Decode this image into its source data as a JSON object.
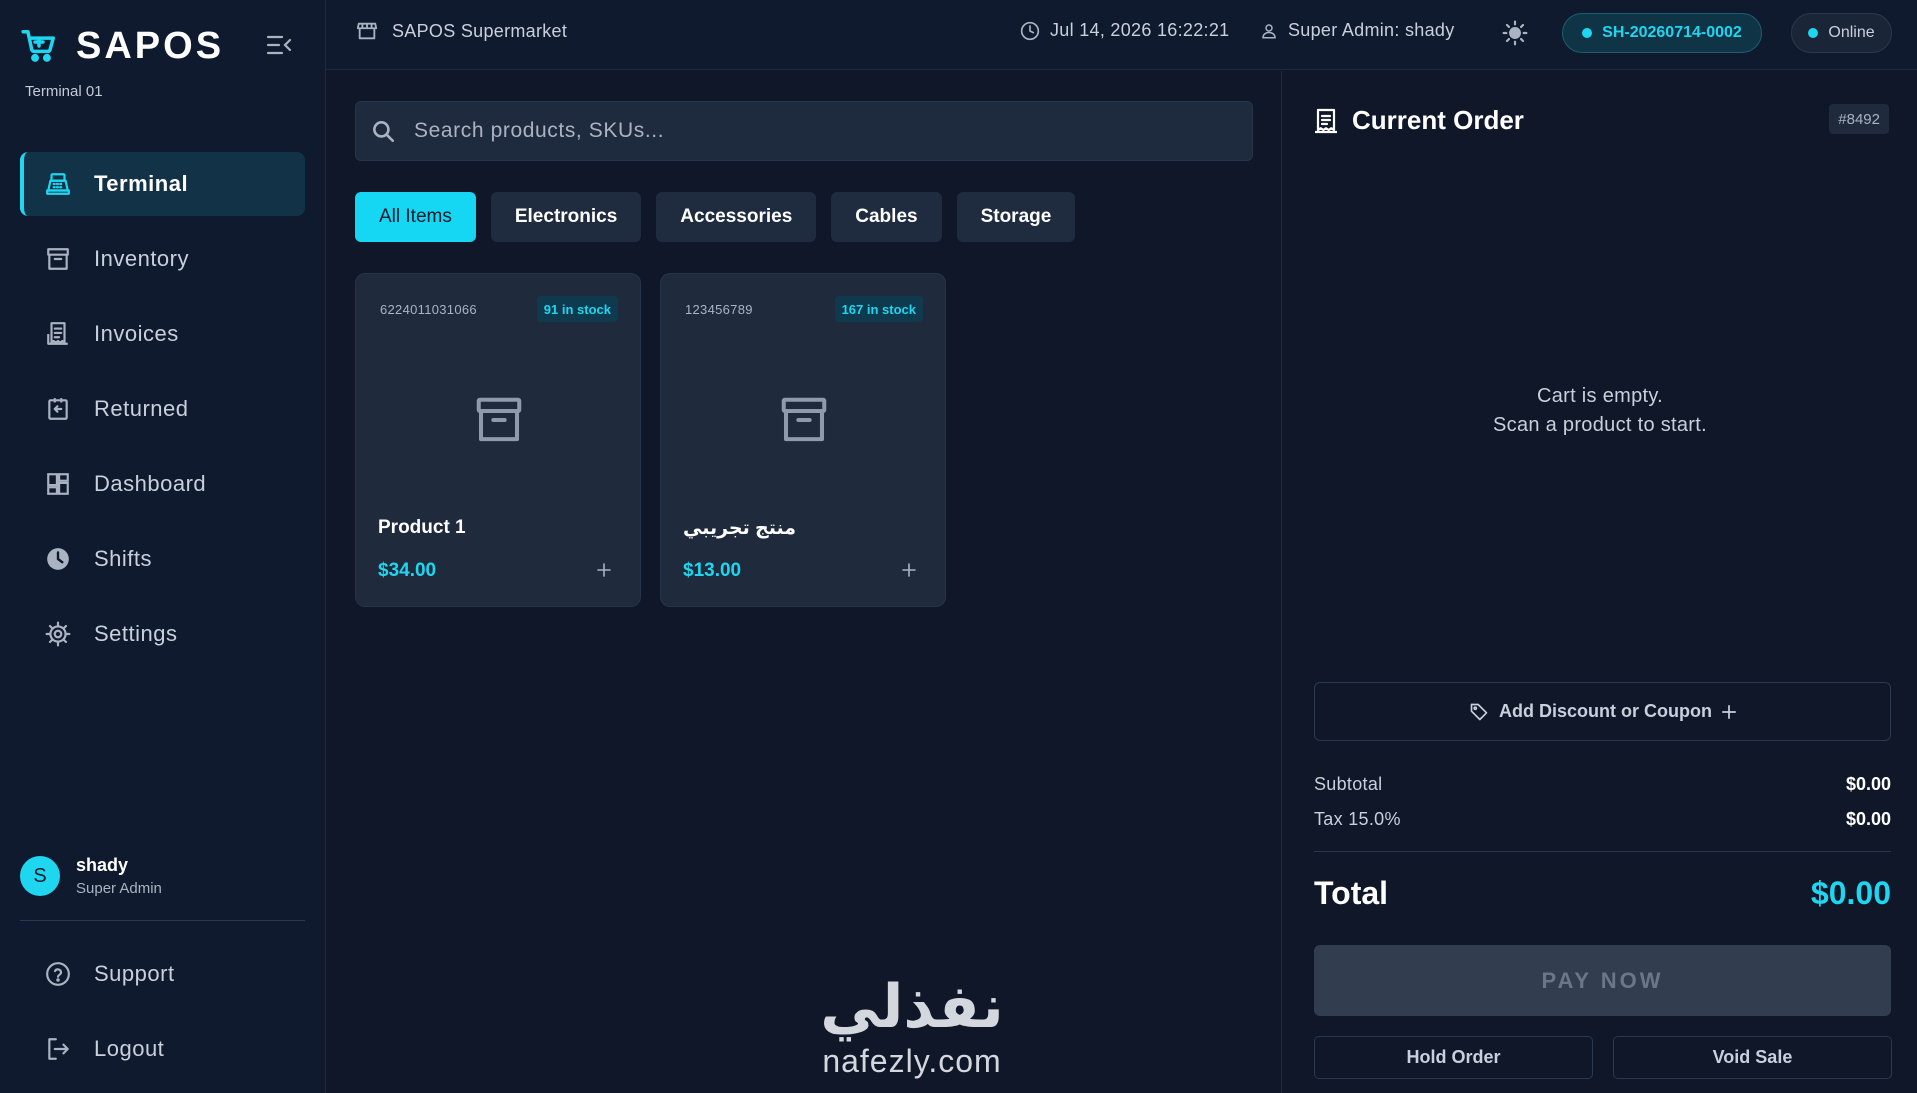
{
  "brand": {
    "name": "SAPOS",
    "terminal": "Terminal 01",
    "accent": "#1fd6f0"
  },
  "sidebar": {
    "items": [
      {
        "label": "Terminal",
        "icon": "register-icon",
        "active": true
      },
      {
        "label": "Inventory",
        "icon": "archive-icon"
      },
      {
        "label": "Invoices",
        "icon": "receipt-icon"
      },
      {
        "label": "Returned",
        "icon": "return-icon"
      },
      {
        "label": "Dashboard",
        "icon": "dashboard-icon"
      },
      {
        "label": "Shifts",
        "icon": "clock-icon"
      },
      {
        "label": "Settings",
        "icon": "gear-icon"
      }
    ],
    "user": {
      "initial": "S",
      "name": "shady",
      "role": "Super Admin"
    },
    "bottom": [
      {
        "label": "Support",
        "icon": "help-icon"
      },
      {
        "label": "Logout",
        "icon": "logout-icon"
      }
    ]
  },
  "topbar": {
    "store": "SAPOS Supermarket",
    "datetime": "Jul 14, 2026 16:22:21",
    "admin": "Super Admin: shady",
    "shift_id": "SH-20260714-0002",
    "status": "Online"
  },
  "search": {
    "placeholder": "Search products, SKUs..."
  },
  "categories": [
    "All Items",
    "Electronics",
    "Accessories",
    "Cables",
    "Storage"
  ],
  "products": [
    {
      "sku": "6224011031066",
      "stock": "91 in stock",
      "name": "Product 1",
      "price": "$34.00"
    },
    {
      "sku": "123456789",
      "stock": "167 in stock",
      "name": "منتج تجريبي",
      "price": "$13.00"
    }
  ],
  "watermark": {
    "arabic": "نفذلي",
    "latin": "nafezly.com"
  },
  "order": {
    "title": "Current Order",
    "number": "#8492",
    "empty_line1": "Cart is empty.",
    "empty_line2": "Scan a product to start.",
    "discount_label": "Add Discount or Coupon",
    "subtotal_label": "Subtotal",
    "subtotal": "$0.00",
    "tax_label": "Tax 15.0%",
    "tax": "$0.00",
    "total_label": "Total",
    "total": "$0.00",
    "pay_label": "PAY NOW",
    "hold_label": "Hold Order",
    "void_label": "Void Sale"
  }
}
